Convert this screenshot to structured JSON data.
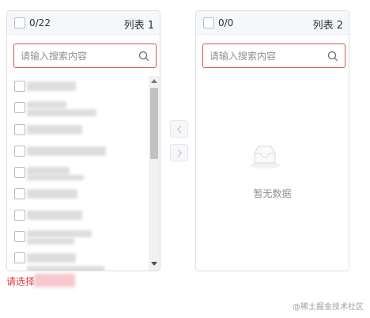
{
  "left_panel": {
    "count": "0/22",
    "title": "列表 1",
    "search_placeholder": "请输入搜索内容",
    "items": [
      {
        "label": "",
        "checked": false
      },
      {
        "label": "",
        "checked": false
      },
      {
        "label": "",
        "checked": false
      },
      {
        "label": "",
        "checked": false
      },
      {
        "label": "",
        "checked": false
      },
      {
        "label": "",
        "checked": false
      },
      {
        "label": "",
        "checked": false
      },
      {
        "label": "",
        "checked": false
      },
      {
        "label": "",
        "checked": false
      },
      {
        "label": "",
        "checked": false
      },
      {
        "label": "",
        "checked": false
      }
    ]
  },
  "right_panel": {
    "count": "0/0",
    "title": "列表 2",
    "search_placeholder": "请输入搜索内容",
    "empty_text": "暂无数据",
    "empty_icon": "inbox-icon"
  },
  "buttons": {
    "to_left_icon": "chevron-left-icon",
    "to_right_icon": "chevron-right-icon"
  },
  "form": {
    "error_text": "请选择"
  },
  "watermark": "@稀土掘金技术社区",
  "colors": {
    "error": "#e4393c",
    "border": "#dcdfe6",
    "header_bg": "#f5f7fa"
  }
}
